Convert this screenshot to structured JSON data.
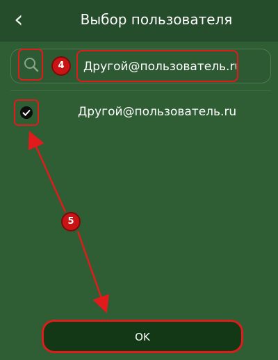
{
  "header": {
    "back_icon": "chevron-left-icon",
    "back_glyph": "‹",
    "title": "Выбор пользователя"
  },
  "search": {
    "icon": "search-icon",
    "value": "Другой@пользователь.ru",
    "step_badge": "4"
  },
  "list": {
    "items": [
      {
        "label": "Другой@пользователь.ru",
        "checked": true,
        "icon": "checkmark-icon"
      }
    ]
  },
  "annotation": {
    "step_badge": "5"
  },
  "footer": {
    "ok_label": "OK"
  },
  "colors": {
    "background": "#2f5e35",
    "header": "#254d2b",
    "button": "#123816",
    "highlight": "#e11b1b"
  }
}
